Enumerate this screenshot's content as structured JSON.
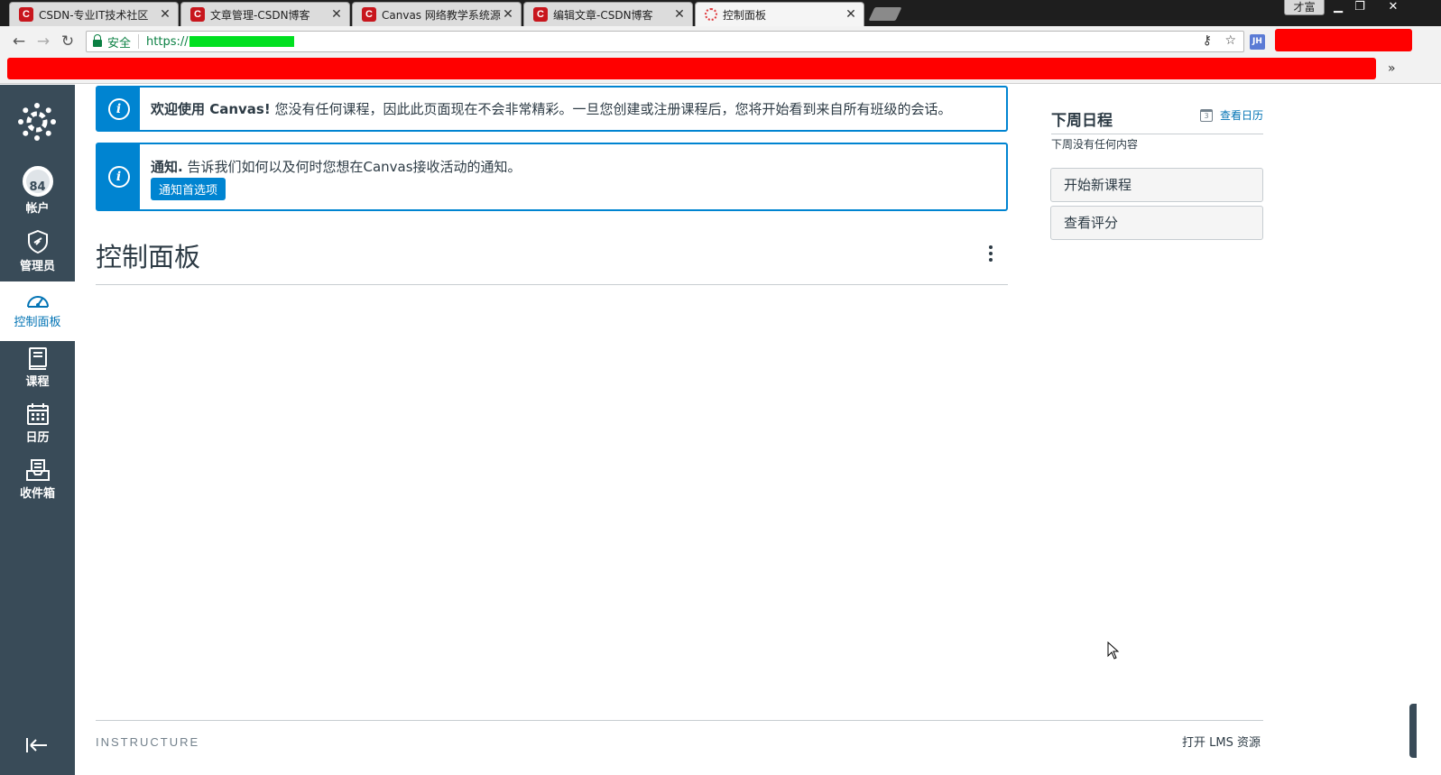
{
  "browser": {
    "tabs": [
      {
        "title": "CSDN-专业IT技术社区",
        "favicon": "csdn-icon"
      },
      {
        "title": "文章管理-CSDN博客",
        "favicon": "csdn-icon"
      },
      {
        "title": "Canvas 网络教学系统源",
        "favicon": "csdn-icon"
      },
      {
        "title": "编辑文章-CSDN博客",
        "favicon": "csdn-icon"
      },
      {
        "title": "控制面板",
        "favicon": "canvas-icon",
        "active": true
      }
    ],
    "tab_close_glyph": "✕",
    "window_user": "才富",
    "window_buttons": {
      "minimize": "▁",
      "restore": "❐",
      "close": "✕"
    },
    "security_label": "安全",
    "url_prefix": "https://",
    "redaction_color": "#ff0000",
    "url_redaction_color": "#00e020",
    "extension_label": "JH",
    "bookmarks_more": "»"
  },
  "globalnav": {
    "background": "#394b58",
    "items": [
      {
        "label": "帐户",
        "icon": "avatar-icon",
        "avatar_text": "84"
      },
      {
        "label": "管理员",
        "icon": "shield-icon"
      },
      {
        "label": "控制面板",
        "icon": "dashboard-gauge-icon",
        "active": true
      },
      {
        "label": "课程",
        "icon": "book-icon"
      },
      {
        "label": "日历",
        "icon": "calendar-icon"
      },
      {
        "label": "收件箱",
        "icon": "inbox-icon"
      }
    ]
  },
  "alerts": {
    "welcome": {
      "title": "欢迎使用 Canvas!",
      "text": "您没有任何课程，因此此页面现在不会非常精彩。一旦您创建或注册课程后，您将开始看到来自所有班级的会话。"
    },
    "notifications": {
      "title": "通知.",
      "text": "告诉我们如何以及何时您想在Canvas接收活动的通知。",
      "button": "通知首选项"
    },
    "accent": "#0084d1"
  },
  "main": {
    "title": "控制面板"
  },
  "sidebar": {
    "heading": "下周日程",
    "calendar_link": "查看日历",
    "calendar_icon_day": "3",
    "empty_text": "下周没有任何内容",
    "buttons": [
      "开始新课程",
      "查看评分"
    ]
  },
  "footer": {
    "brand": "INSTRUCTURE",
    "link": "打开 LMS 资源"
  }
}
